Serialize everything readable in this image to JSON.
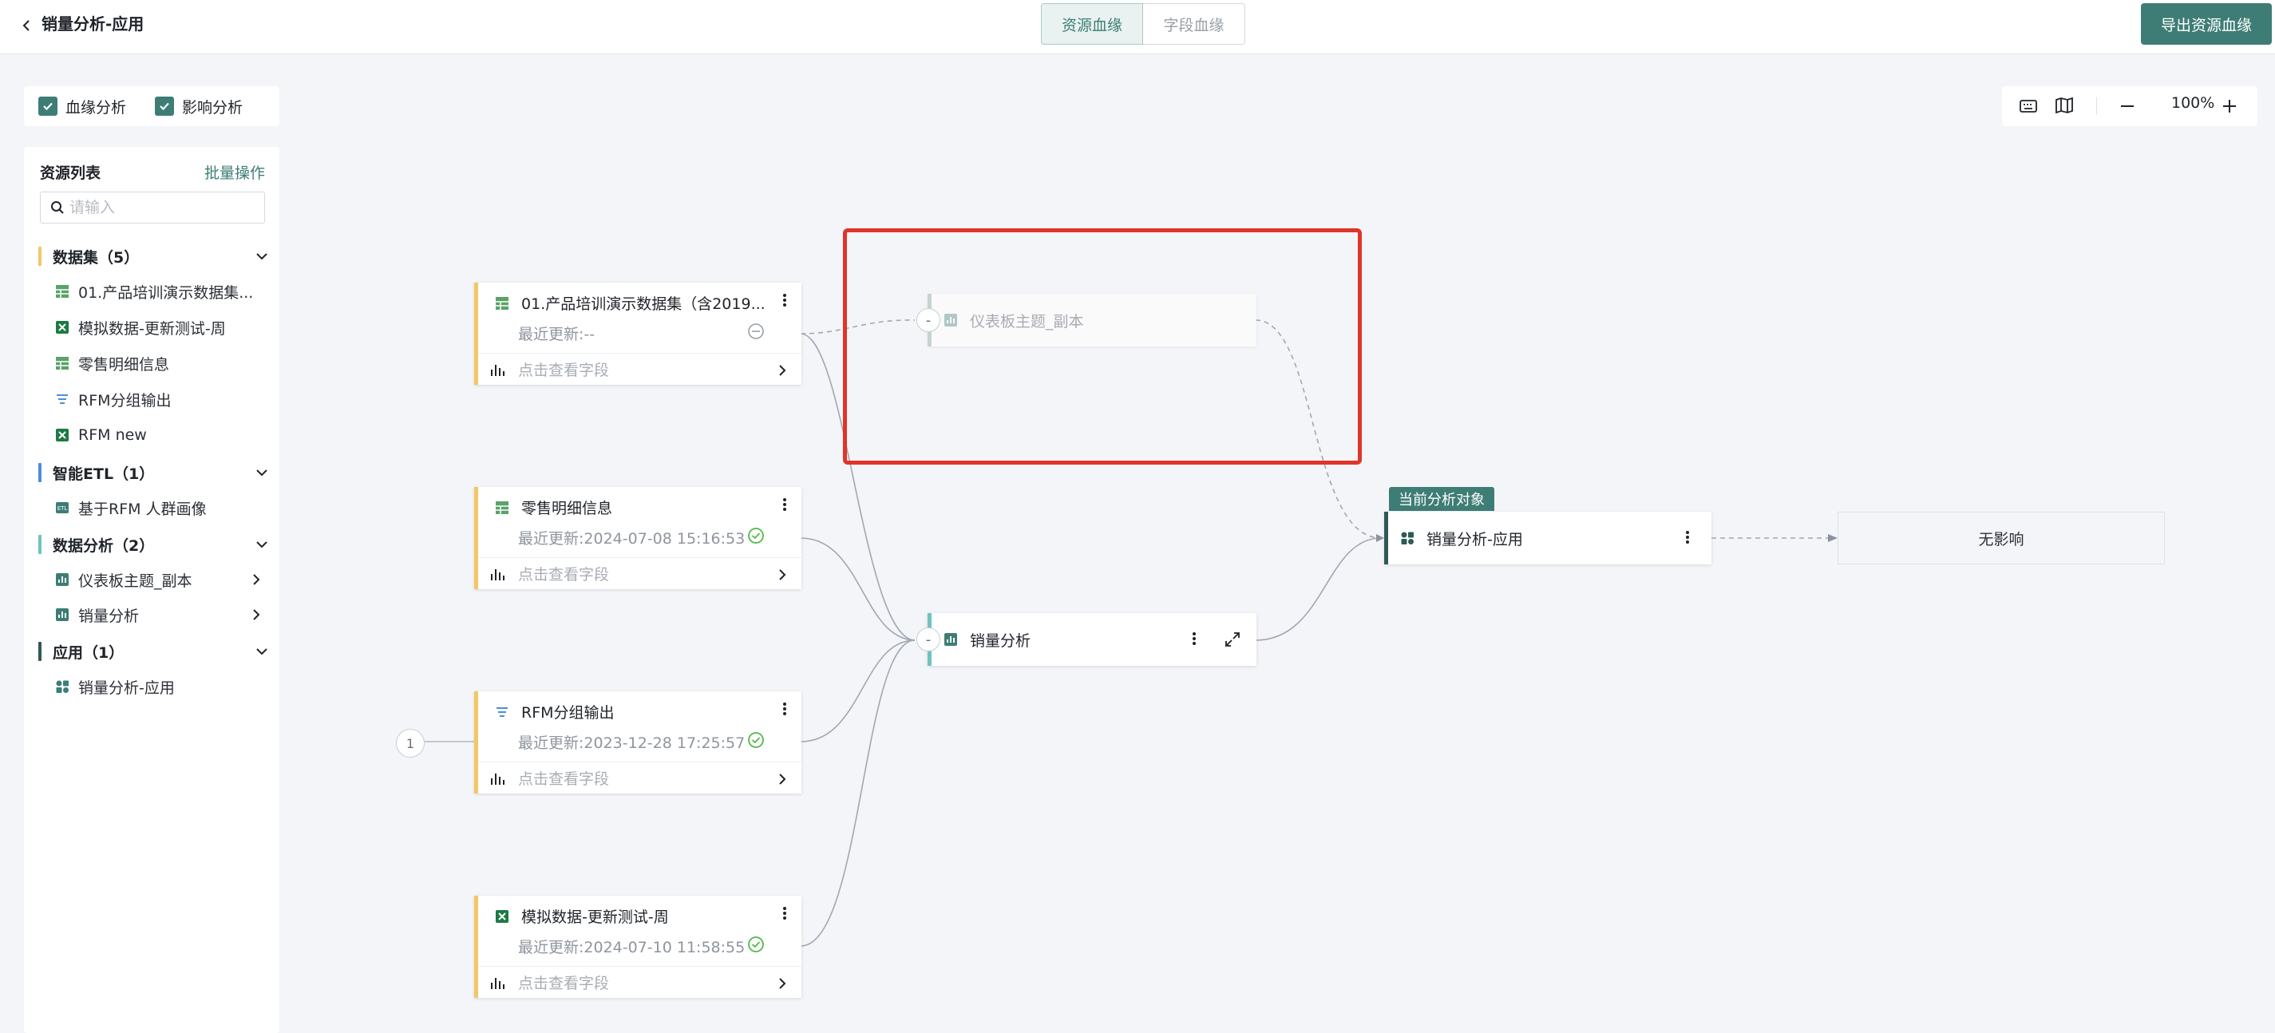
{
  "header": {
    "title": "销量分析-应用",
    "tabs": [
      {
        "label": "资源血缘",
        "active": true
      },
      {
        "label": "字段血缘",
        "active": false
      }
    ],
    "export_label": "导出资源血缘"
  },
  "analysis": {
    "lineage_label": "血缘分析",
    "lineage_checked": true,
    "impact_label": "影响分析",
    "impact_checked": true
  },
  "resource_panel": {
    "title": "资源列表",
    "batch_label": "批量操作",
    "search_placeholder": "请输入",
    "groups": [
      {
        "label": "数据集（5）",
        "color": "#f0c866",
        "items": [
          "01.产品培训演示数据集...",
          "模拟数据-更新测试-周",
          "零售明细信息",
          "RFM分组输出",
          "RFM new"
        ]
      },
      {
        "label": "智能ETL（1）",
        "color": "#4a8fd8",
        "items": [
          "基于RFM 人群画像"
        ]
      },
      {
        "label": "数据分析（2）",
        "color": "#6fc3c0",
        "items": [
          "仪表板主题_副本",
          "销量分析"
        ]
      },
      {
        "label": "应用（1）",
        "color": "#2e5a55",
        "items": [
          "销量分析-应用"
        ]
      }
    ]
  },
  "canvas": {
    "zoom": "100%",
    "upstream_count": "1",
    "datasets": [
      {
        "name": "01.产品培训演示数据集（含2019...",
        "updated": "最近更新:--",
        "status": "none",
        "view_fields": "点击查看字段"
      },
      {
        "name": "零售明细信息",
        "updated": "最近更新:2024-07-08 15:16:53",
        "status": "ok",
        "view_fields": "点击查看字段"
      },
      {
        "name": "RFM分组输出",
        "updated": "最近更新:2023-12-28 17:25:57",
        "status": "ok",
        "view_fields": "点击查看字段"
      },
      {
        "name": "模拟数据-更新测试-周",
        "updated": "最近更新:2024-07-10 11:58:55",
        "status": "ok",
        "view_fields": "点击查看字段"
      }
    ],
    "dashboard_copy": "仪表板主题_副本",
    "sales_analysis": "销量分析",
    "current_tag": "当前分析对象",
    "current_object": "销量分析-应用",
    "no_impact": "无影响",
    "collapse_symbol": "-"
  },
  "colors": {
    "accent": "#3e7d75",
    "dataset": "#f0c866",
    "analysis": "#6fc3c0",
    "highlight": "#e0342a"
  }
}
